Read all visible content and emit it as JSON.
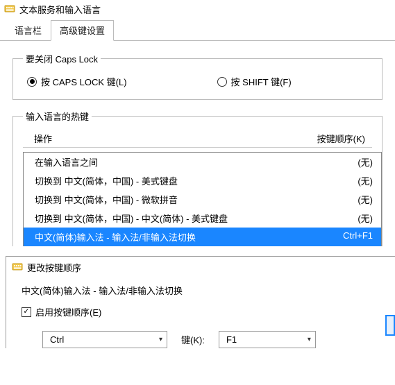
{
  "window": {
    "title": "文本服务和输入语言"
  },
  "tabs": [
    {
      "label": "语言栏",
      "active": false
    },
    {
      "label": "高级键设置",
      "active": true
    }
  ],
  "capslock": {
    "legend": "要关闭 Caps Lock",
    "opt_capslock": "按 CAPS LOCK 键(L)",
    "opt_shift": "按 SHIFT 键(F)"
  },
  "hotkeys": {
    "legend": "输入语言的热键",
    "header_action": "操作",
    "header_key": "按键顺序(K)",
    "rows": [
      {
        "action": "在输入语言之间",
        "key": "(无)",
        "selected": false
      },
      {
        "action": "切换到 中文(简体，中国) - 美式键盘",
        "key": "(无)",
        "selected": false
      },
      {
        "action": "切换到 中文(简体，中国) - 微软拼音",
        "key": "(无)",
        "selected": false
      },
      {
        "action": "切换到 中文(简体，中国) - 中文(简体) - 美式键盘",
        "key": "(无)",
        "selected": false
      },
      {
        "action": "中文(简体)输入法 - 输入法/非输入法切换",
        "key": "Ctrl+F1",
        "selected": true
      }
    ]
  },
  "subdialog": {
    "title": "更改按键顺序",
    "subject": "中文(简体)输入法 - 输入法/非输入法切换",
    "enable_label": "启用按键顺序(E)",
    "enabled": true,
    "modifier": "Ctrl",
    "key_label": "键(K):",
    "key": "F1"
  }
}
